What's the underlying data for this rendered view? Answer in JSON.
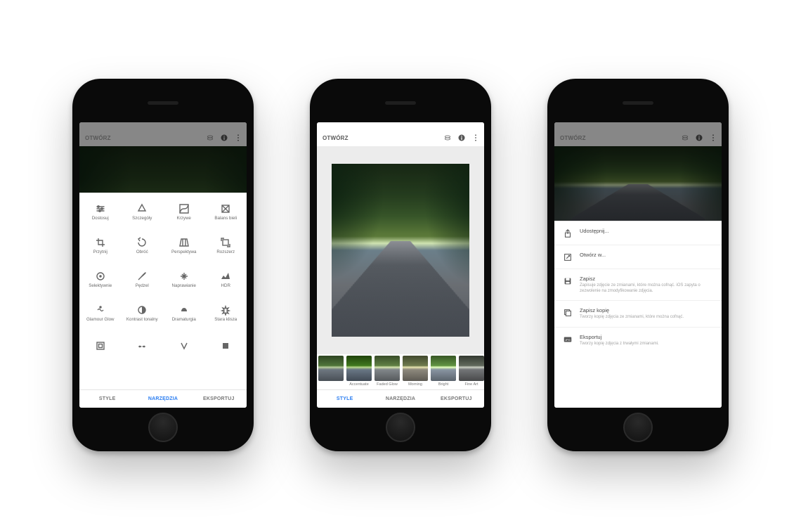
{
  "header": {
    "title": "OTWÓRZ"
  },
  "tabs": {
    "style": "STYLE",
    "tools": "NARZĘDZIA",
    "export": "EKSPORTUJ"
  },
  "tools_grid": [
    "Dostosuj",
    "Szczegóły",
    "Krzywe",
    "Balans bieli",
    "Przytnij",
    "Obróć",
    "Perspektywa",
    "Rozszerz",
    "Selektywnie",
    "Pędzel",
    "Naprawianie",
    "HDR",
    "Glamour Glow",
    "Kontrast tonalny",
    "Dramaturgia",
    "Stara klisza",
    "",
    "",
    "",
    ""
  ],
  "tool_icons": [
    "sliders",
    "details",
    "curves",
    "white-balance",
    "crop",
    "rotate",
    "perspective",
    "expand",
    "selective",
    "brush",
    "healing",
    "hdr",
    "glamour",
    "tonal",
    "drama",
    "vintage",
    "frame",
    "mustache",
    "v",
    "square"
  ],
  "styles_strip": [
    "",
    "Accentuate",
    "Faded Glow",
    "Morning",
    "Bright",
    "Fine Art"
  ],
  "export_menu": [
    {
      "icon": "share",
      "title": "Udostępnij...",
      "sub": ""
    },
    {
      "icon": "openin",
      "title": "Otwórz w...",
      "sub": ""
    },
    {
      "icon": "save",
      "title": "Zapisz",
      "sub": "Zapisuje zdjęcie ze zmianami, które można cofnąć. iOS zapyta o zezwolenie na zmodyfikowanie zdjęcia."
    },
    {
      "icon": "copy",
      "title": "Zapisz kopię",
      "sub": "Tworzy kopię zdjęcia ze zmianami, które można cofnąć."
    },
    {
      "icon": "jpg",
      "title": "Eksportuj",
      "sub": "Tworzy kopię zdjęcia z trwałymi zmianami."
    }
  ],
  "style_filters": {
    "0": "none",
    "1": "saturate(1.4) contrast(1.1)",
    "2": "brightness(1.1) sepia(.15)",
    "3": "sepia(.5) brightness(1.05)",
    "4": "brightness(1.25) saturate(1.1)",
    "5": "grayscale(.8) contrast(1.1)"
  }
}
